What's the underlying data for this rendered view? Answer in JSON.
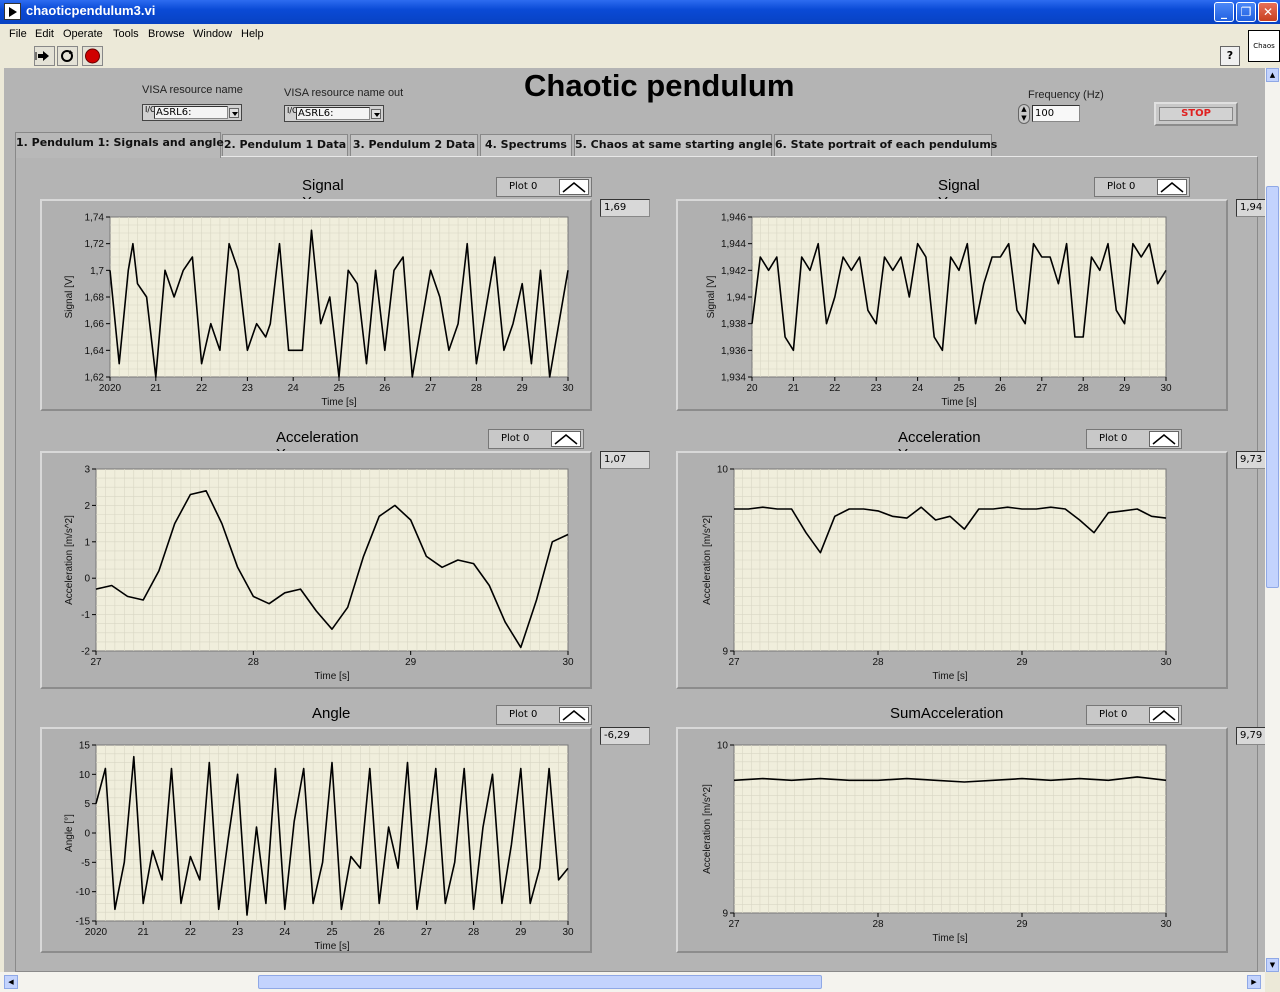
{
  "window": {
    "title": "chaoticpendulum3.vi",
    "minimize_label": "_",
    "restore_label": "❐",
    "close_label": "✕",
    "vi_icon_text": "Chaos"
  },
  "menu": [
    "File",
    "Edit",
    "Operate",
    "Tools",
    "Browse",
    "Window",
    "Help"
  ],
  "toolbar": {
    "run_icon": "run-continuous-arrow-icon",
    "abort_icon": "abort-icon",
    "help_label": "?"
  },
  "controls": {
    "visa_in_label": "VISA resource name",
    "visa_in_value": "ASRL6:",
    "visa_out_label": "VISA resource name out",
    "visa_out_value": "ASRL6:",
    "visa_prefix": "I/O",
    "frequency_label": "Frequency (Hz)",
    "frequency_value": "100",
    "stop_label": "STOP"
  },
  "page_title": "Chaotic pendulum",
  "tabs": [
    "1. Pendulum 1: Signals and angle",
    "2. Pendulum 1 Data",
    "3. Pendulum 2 Data",
    "4. Spectrums",
    "5. Chaos at same starting angle",
    "6. State portrait of each pendulums"
  ],
  "active_tab": 0,
  "graphs": [
    {
      "title": "Signal X",
      "legend": "Plot 0",
      "indicator": "1,69"
    },
    {
      "title": "Signal Y",
      "legend": "Plot 0",
      "indicator": "1,94"
    },
    {
      "title": "Acceleration X",
      "legend": "Plot 0",
      "indicator": "1,07"
    },
    {
      "title": "Acceleration Y",
      "legend": "Plot 0",
      "indicator": "9,73"
    },
    {
      "title": "Angle",
      "legend": "Plot 0",
      "indicator": "-6,29"
    },
    {
      "title": "SumAcceleration",
      "legend": "Plot 0",
      "indicator": "9,79"
    }
  ],
  "chart_data": [
    {
      "type": "line",
      "title": "Signal X",
      "xlabel": "Time [s]",
      "ylabel": "Signal [V]",
      "xlim": [
        20,
        30
      ],
      "ylim": [
        1.62,
        1.74
      ],
      "x_ticks": [
        "2020",
        "21",
        "22",
        "23",
        "24",
        "25",
        "26",
        "27",
        "28",
        "29",
        "30"
      ],
      "y_ticks": [
        "1,62",
        "1,64",
        "1,66",
        "1,68",
        "1,7",
        "1,72",
        "1,74"
      ],
      "grid": true,
      "series": [
        {
          "name": "Plot 0",
          "x": [
            20.0,
            20.2,
            20.4,
            20.5,
            20.6,
            20.8,
            21.0,
            21.2,
            21.4,
            21.6,
            21.8,
            22.0,
            22.2,
            22.4,
            22.6,
            22.8,
            23.0,
            23.2,
            23.4,
            23.5,
            23.7,
            23.9,
            24.2,
            24.4,
            24.6,
            24.8,
            25.0,
            25.2,
            25.4,
            25.6,
            25.8,
            26.0,
            26.2,
            26.4,
            26.6,
            26.8,
            27.0,
            27.2,
            27.4,
            27.6,
            27.8,
            28.0,
            28.2,
            28.4,
            28.6,
            28.8,
            29.0,
            29.2,
            29.4,
            29.6,
            29.8,
            30.0
          ],
          "y": [
            1.7,
            1.63,
            1.7,
            1.72,
            1.69,
            1.68,
            1.62,
            1.7,
            1.68,
            1.7,
            1.71,
            1.63,
            1.66,
            1.64,
            1.72,
            1.7,
            1.64,
            1.66,
            1.65,
            1.66,
            1.72,
            1.64,
            1.64,
            1.73,
            1.66,
            1.68,
            1.62,
            1.7,
            1.69,
            1.63,
            1.7,
            1.64,
            1.7,
            1.71,
            1.62,
            1.66,
            1.7,
            1.68,
            1.64,
            1.66,
            1.72,
            1.63,
            1.67,
            1.71,
            1.64,
            1.66,
            1.69,
            1.63,
            1.7,
            1.62,
            1.66,
            1.7
          ]
        }
      ]
    },
    {
      "type": "line",
      "title": "Signal Y",
      "xlabel": "Time [s]",
      "ylabel": "Signal [V]",
      "xlim": [
        20,
        30
      ],
      "ylim": [
        1.934,
        1.946
      ],
      "x_ticks": [
        "20",
        "21",
        "22",
        "23",
        "24",
        "25",
        "26",
        "27",
        "28",
        "29",
        "30"
      ],
      "y_ticks": [
        "1,934",
        "1,936",
        "1,938",
        "1,94",
        "1,942",
        "1,944",
        "1,946"
      ],
      "grid": true,
      "series": [
        {
          "name": "Plot 0",
          "x": [
            20.0,
            20.2,
            20.4,
            20.6,
            20.8,
            21.0,
            21.2,
            21.4,
            21.6,
            21.8,
            22.0,
            22.2,
            22.4,
            22.6,
            22.8,
            23.0,
            23.2,
            23.4,
            23.6,
            23.8,
            24.0,
            24.2,
            24.4,
            24.6,
            24.8,
            25.0,
            25.2,
            25.4,
            25.6,
            25.8,
            26.0,
            26.2,
            26.4,
            26.6,
            26.8,
            27.0,
            27.2,
            27.4,
            27.6,
            27.8,
            28.0,
            28.2,
            28.4,
            28.6,
            28.8,
            29.0,
            29.2,
            29.4,
            29.6,
            29.8,
            30.0
          ],
          "y": [
            1.938,
            1.943,
            1.942,
            1.943,
            1.937,
            1.936,
            1.943,
            1.942,
            1.944,
            1.938,
            1.94,
            1.943,
            1.942,
            1.943,
            1.939,
            1.938,
            1.943,
            1.942,
            1.943,
            1.94,
            1.944,
            1.943,
            1.937,
            1.936,
            1.943,
            1.942,
            1.944,
            1.938,
            1.941,
            1.943,
            1.943,
            1.944,
            1.939,
            1.938,
            1.944,
            1.943,
            1.943,
            1.941,
            1.944,
            1.937,
            1.937,
            1.943,
            1.942,
            1.944,
            1.939,
            1.938,
            1.944,
            1.943,
            1.944,
            1.941,
            1.942
          ]
        }
      ]
    },
    {
      "type": "line",
      "title": "Acceleration X",
      "xlabel": "Time [s]",
      "ylabel": "Acceleration [m/s^2]",
      "xlim": [
        27,
        30
      ],
      "ylim": [
        -2,
        3
      ],
      "x_ticks": [
        "27",
        "28",
        "29",
        "30"
      ],
      "y_ticks": [
        "-2",
        "-1",
        "0",
        "1",
        "2",
        "3"
      ],
      "grid": true,
      "series": [
        {
          "name": "Plot 0",
          "x": [
            27.0,
            27.1,
            27.2,
            27.3,
            27.4,
            27.5,
            27.6,
            27.7,
            27.8,
            27.9,
            28.0,
            28.1,
            28.2,
            28.3,
            28.4,
            28.5,
            28.6,
            28.7,
            28.8,
            28.9,
            29.0,
            29.1,
            29.2,
            29.3,
            29.4,
            29.5,
            29.6,
            29.7,
            29.8,
            29.9,
            30.0
          ],
          "y": [
            -0.3,
            -0.2,
            -0.5,
            -0.6,
            0.2,
            1.5,
            2.3,
            2.4,
            1.5,
            0.3,
            -0.5,
            -0.7,
            -0.4,
            -0.3,
            -0.9,
            -1.4,
            -0.8,
            0.6,
            1.7,
            2.0,
            1.6,
            0.6,
            0.3,
            0.5,
            0.4,
            -0.2,
            -1.2,
            -1.9,
            -0.6,
            1.0,
            1.2
          ]
        }
      ]
    },
    {
      "type": "line",
      "title": "Acceleration Y",
      "xlabel": "Time [s]",
      "ylabel": "Acceleration [m/s^2]",
      "xlim": [
        27,
        30
      ],
      "ylim": [
        9,
        10
      ],
      "x_ticks": [
        "27",
        "28",
        "29",
        "30"
      ],
      "y_ticks": [
        "9",
        "10"
      ],
      "grid": true,
      "series": [
        {
          "name": "Plot 0",
          "x": [
            27.0,
            27.1,
            27.2,
            27.3,
            27.4,
            27.5,
            27.6,
            27.7,
            27.8,
            27.9,
            28.0,
            28.1,
            28.2,
            28.3,
            28.4,
            28.5,
            28.6,
            28.7,
            28.8,
            28.9,
            29.0,
            29.1,
            29.2,
            29.3,
            29.4,
            29.5,
            29.6,
            29.7,
            29.8,
            29.9,
            30.0
          ],
          "y": [
            9.78,
            9.78,
            9.79,
            9.78,
            9.78,
            9.65,
            9.54,
            9.74,
            9.78,
            9.78,
            9.77,
            9.74,
            9.73,
            9.79,
            9.72,
            9.74,
            9.67,
            9.78,
            9.78,
            9.79,
            9.78,
            9.78,
            9.79,
            9.78,
            9.72,
            9.65,
            9.76,
            9.77,
            9.78,
            9.74,
            9.73
          ]
        }
      ]
    },
    {
      "type": "line",
      "title": "Angle",
      "xlabel": "Time [s]",
      "ylabel": "Angle [°]",
      "xlim": [
        20,
        30
      ],
      "ylim": [
        -15,
        15
      ],
      "x_ticks": [
        "2020",
        "21",
        "22",
        "23",
        "24",
        "25",
        "26",
        "27",
        "28",
        "29",
        "30"
      ],
      "y_ticks": [
        "-15",
        "-10",
        "-5",
        "0",
        "5",
        "10",
        "15"
      ],
      "grid": true,
      "series": [
        {
          "name": "Plot 0",
          "x": [
            20.0,
            20.2,
            20.4,
            20.6,
            20.8,
            21.0,
            21.2,
            21.4,
            21.6,
            21.8,
            22.0,
            22.2,
            22.4,
            22.6,
            22.8,
            23.0,
            23.2,
            23.4,
            23.6,
            23.8,
            24.0,
            24.2,
            24.4,
            24.6,
            24.8,
            25.0,
            25.2,
            25.4,
            25.6,
            25.8,
            26.0,
            26.2,
            26.4,
            26.6,
            26.8,
            27.0,
            27.2,
            27.4,
            27.6,
            27.8,
            28.0,
            28.2,
            28.4,
            28.6,
            28.8,
            29.0,
            29.2,
            29.4,
            29.6,
            29.8,
            30.0
          ],
          "y": [
            5,
            11,
            -13,
            -5,
            13,
            -12,
            -3,
            -8,
            11,
            -12,
            -4,
            -8,
            12,
            -13,
            -1,
            10,
            -14,
            1,
            -12,
            11,
            -13,
            2,
            11,
            -12,
            -5,
            12,
            -13,
            -4,
            -6,
            11,
            -12,
            1,
            -6,
            12,
            -13,
            -2,
            11,
            -12,
            -5,
            11,
            -13,
            1,
            10,
            -12,
            -2,
            11,
            -12,
            -6,
            11,
            -8,
            -6
          ]
        }
      ]
    },
    {
      "type": "line",
      "title": "SumAcceleration",
      "xlabel": "Time [s]",
      "ylabel": "Acceleration [m/s^2]",
      "xlim": [
        27,
        30
      ],
      "ylim": [
        9,
        10
      ],
      "x_ticks": [
        "27",
        "28",
        "29",
        "30"
      ],
      "y_ticks": [
        "9",
        "10"
      ],
      "grid": true,
      "series": [
        {
          "name": "Plot 0",
          "x": [
            27.0,
            27.2,
            27.4,
            27.6,
            27.8,
            28.0,
            28.2,
            28.4,
            28.6,
            28.8,
            29.0,
            29.2,
            29.4,
            29.6,
            29.8,
            30.0
          ],
          "y": [
            9.79,
            9.8,
            9.79,
            9.8,
            9.79,
            9.79,
            9.8,
            9.79,
            9.78,
            9.79,
            9.8,
            9.79,
            9.8,
            9.79,
            9.81,
            9.79
          ]
        }
      ]
    }
  ],
  "status": {
    "partial_text": ""
  }
}
